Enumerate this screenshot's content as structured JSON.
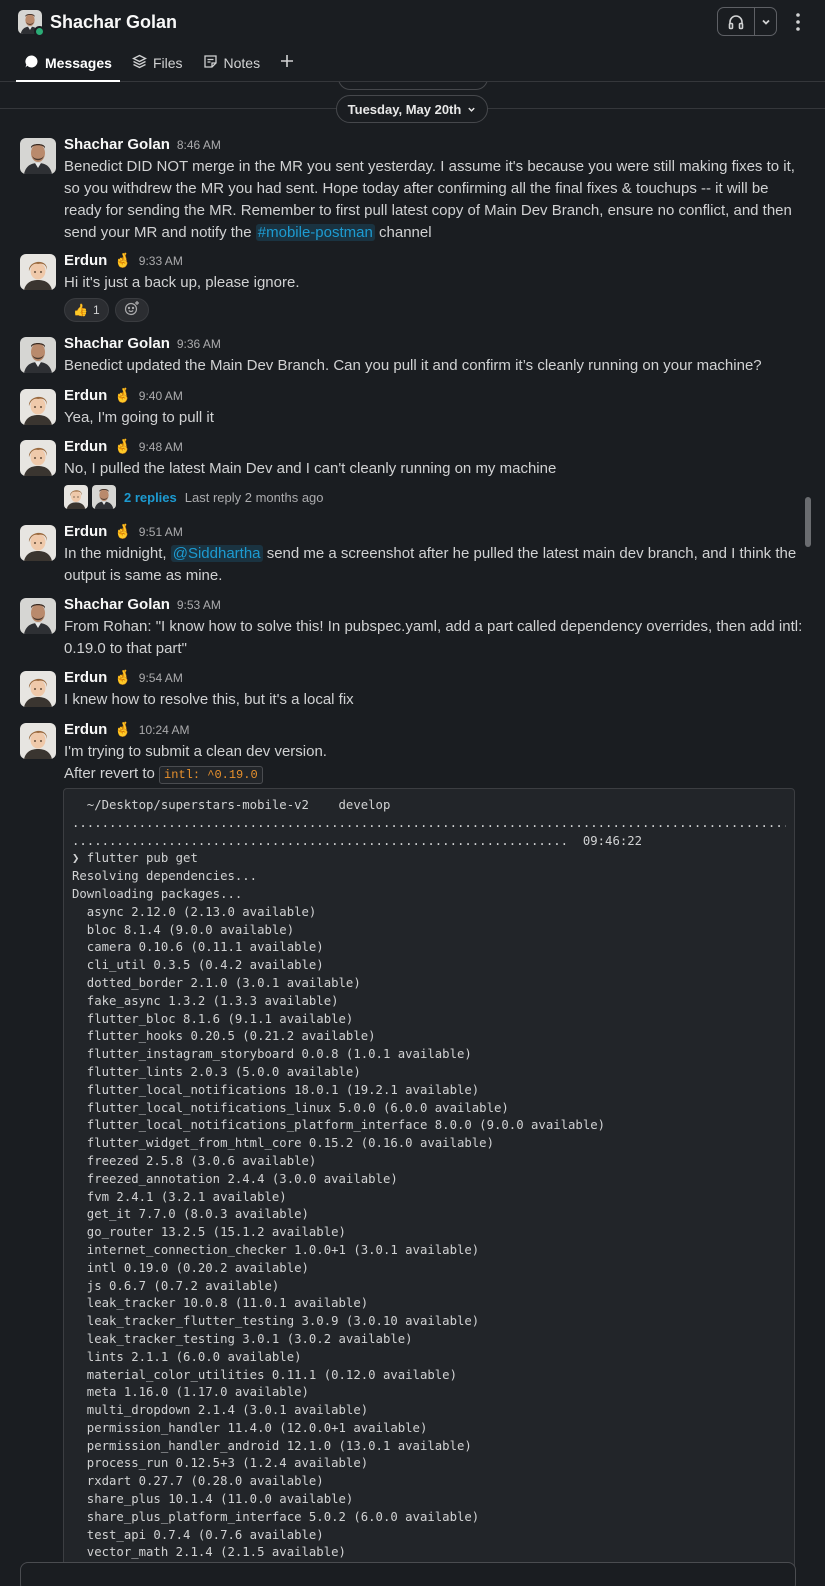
{
  "header": {
    "title": "Shachar Golan",
    "tabs": [
      {
        "label": "Messages",
        "icon": "message-bubble-icon",
        "active": true
      },
      {
        "label": "Files",
        "icon": "layers-icon",
        "active": false
      },
      {
        "label": "Notes",
        "icon": "notes-icon",
        "active": false
      }
    ]
  },
  "date_divider": {
    "label": "Tuesday, May 20th"
  },
  "messages": [
    {
      "sender": "Shachar Golan",
      "time": "8:46 AM",
      "text_before_link": "Benedict DID NOT merge in the MR you sent yesterday. I assume it's because you were still making fixes to it, so you withdrew the MR you had sent. Hope today after confirming all the final fixes & touchups -- it will be ready for sending the MR. Remember to first pull latest copy of Main Dev Branch, ensure no conflict, and then send your MR and notify the",
      "channel": "#mobile-postman",
      "text_after_link": "channel"
    },
    {
      "sender": "Erdun",
      "status_emoji": "🤞",
      "time": "9:33 AM",
      "text": "Hi it's just a back up, please ignore.",
      "reaction": {
        "emoji": "👍",
        "count": "1"
      }
    },
    {
      "sender": "Shachar Golan",
      "time": "9:36 AM",
      "text": "Benedict updated the Main Dev Branch. Can you pull it and confirm it’s cleanly running on your machine?"
    },
    {
      "sender": "Erdun",
      "status_emoji": "🤞",
      "time": "9:40 AM",
      "text": "Yea, I'm going to pull it"
    },
    {
      "sender": "Erdun",
      "status_emoji": "🤞",
      "time": "9:48 AM",
      "text": "No, I pulled the latest Main Dev and I can't cleanly running on my machine",
      "thread": {
        "replies": "2 replies",
        "last_reply": "Last reply 2 months ago"
      }
    },
    {
      "sender": "Erdun",
      "status_emoji": "🤞",
      "time": "9:51 AM",
      "text_before_mention": "In the midnight,",
      "mention": "@Siddhartha",
      "text_after_mention": "send me a screenshot after he pulled the latest main dev branch, and I think the output is same as mine."
    },
    {
      "sender": "Shachar Golan",
      "time": "9:53 AM",
      "text": "From Rohan: \"I know how to solve this! In pubspec.yaml, add a part called dependency overrides, then add intl: 0.19.0 to that part\""
    },
    {
      "sender": "Erdun",
      "status_emoji": "🤞",
      "time": "9:54 AM",
      "text": "I knew how to resolve this, but it's a local fix"
    },
    {
      "sender": "Erdun",
      "status_emoji": "🤞",
      "time": "10:24 AM",
      "line1": "I'm trying to submit a clean dev version.",
      "line2_before_code": "After revert to",
      "inline_code": "intl: ^0.19.0"
    }
  ],
  "code_block": {
    "lines": [
      "  ~/Desktop/superstars-mobile-v2    develop",
      "................................................................................................................",
      "...................................................................  09:46:22",
      "❯ flutter pub get",
      "Resolving dependencies...",
      "Downloading packages...",
      "  async 2.12.0 (2.13.0 available)",
      "  bloc 8.1.4 (9.0.0 available)",
      "  camera 0.10.6 (0.11.1 available)",
      "  cli_util 0.3.5 (0.4.2 available)",
      "  dotted_border 2.1.0 (3.0.1 available)",
      "  fake_async 1.3.2 (1.3.3 available)",
      "  flutter_bloc 8.1.6 (9.1.1 available)",
      "  flutter_hooks 0.20.5 (0.21.2 available)",
      "  flutter_instagram_storyboard 0.0.8 (1.0.1 available)",
      "  flutter_lints 2.0.3 (5.0.0 available)",
      "  flutter_local_notifications 18.0.1 (19.2.1 available)",
      "  flutter_local_notifications_linux 5.0.0 (6.0.0 available)",
      "  flutter_local_notifications_platform_interface 8.0.0 (9.0.0 available)",
      "  flutter_widget_from_html_core 0.15.2 (0.16.0 available)",
      "  freezed 2.5.8 (3.0.6 available)",
      "  freezed_annotation 2.4.4 (3.0.0 available)",
      "  fvm 2.4.1 (3.2.1 available)",
      "  get_it 7.7.0 (8.0.3 available)",
      "  go_router 13.2.5 (15.1.2 available)",
      "  internet_connection_checker 1.0.0+1 (3.0.1 available)",
      "  intl 0.19.0 (0.20.2 available)",
      "  js 0.6.7 (0.7.2 available)",
      "  leak_tracker 10.0.8 (11.0.1 available)",
      "  leak_tracker_flutter_testing 3.0.9 (3.0.10 available)",
      "  leak_tracker_testing 3.0.1 (3.0.2 available)",
      "  lints 2.1.1 (6.0.0 available)",
      "  material_color_utilities 0.11.1 (0.12.0 available)",
      "  meta 1.16.0 (1.17.0 available)",
      "  multi_dropdown 2.1.4 (3.0.1 available)",
      "  permission_handler 11.4.0 (12.0.0+1 available)",
      "  permission_handler_android 12.1.0 (13.0.1 available)",
      "  process_run 0.12.5+3 (1.2.4 available)",
      "  rxdart 0.27.7 (0.28.0 available)",
      "  share_plus 10.1.4 (11.0.0 available)",
      "  share_plus_platform_interface 5.0.2 (6.0.0 available)",
      "  test_api 0.7.4 (0.7.6 available)",
      "  vector_math 2.1.4 (2.1.5 available)"
    ]
  },
  "colors": {
    "background": "#1a1d21",
    "link": "#1d9bd1",
    "inline_code": "#e8912d",
    "presence": "#2bac76"
  }
}
